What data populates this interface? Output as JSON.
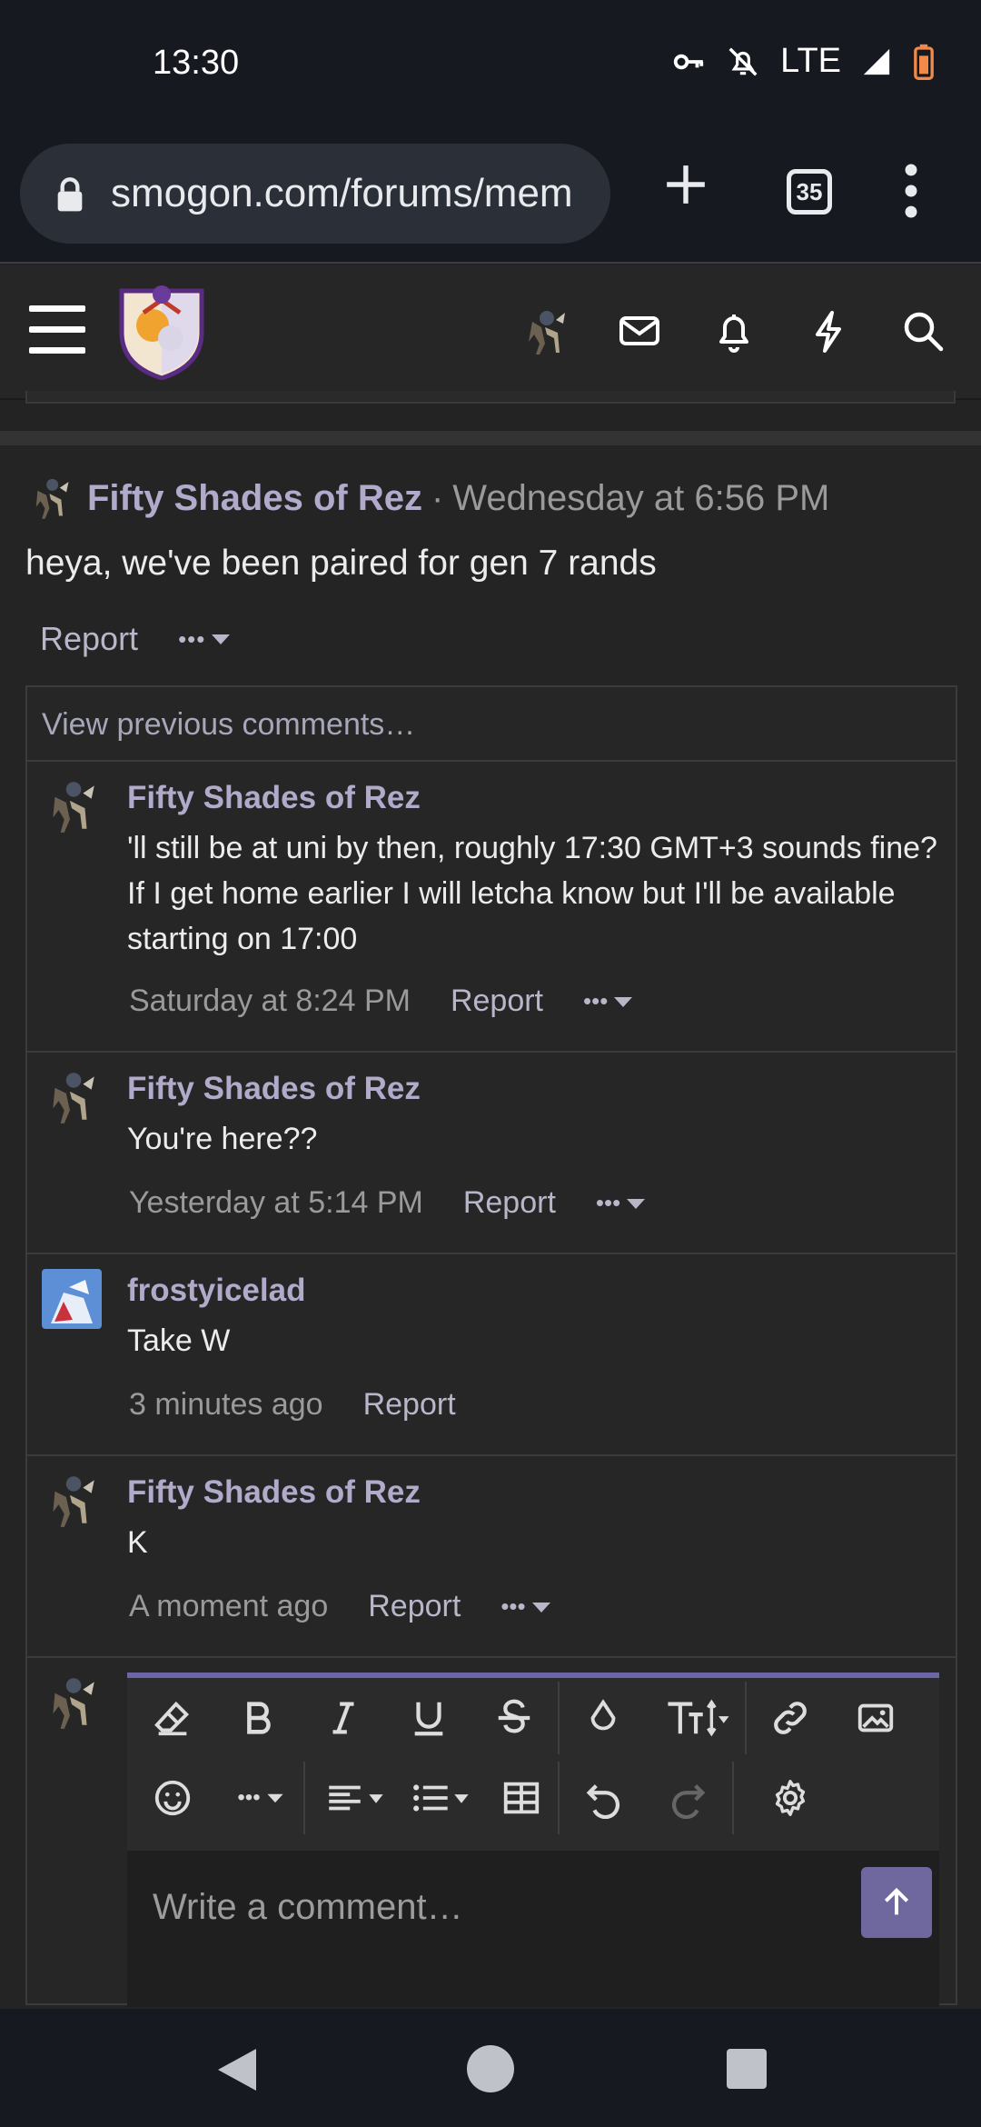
{
  "status_bar": {
    "time": "13:30",
    "network": "LTE",
    "icons": [
      "key-icon",
      "bell-off-icon",
      "signal-icon",
      "battery-icon"
    ]
  },
  "browser": {
    "url": "smogon.com/forums/mem",
    "tab_count": "35",
    "icons": [
      "lock-icon",
      "new-tab-icon",
      "tabs-icon",
      "menu-dots-icon"
    ]
  },
  "site_header": {
    "icons": [
      "hamburger-icon",
      "site-logo",
      "user-avatar",
      "mail-icon",
      "bell-icon",
      "bolt-icon",
      "search-icon"
    ]
  },
  "post": {
    "author": "Fifty Shades of Rez",
    "separator": "·",
    "date": "Wednesday at 6:56 PM",
    "body": "heya, we've been paired for gen 7 rands",
    "report_label": "Report",
    "more_label": "•••"
  },
  "comments": {
    "view_previous": "View previous comments…",
    "items": [
      {
        "author": "Fifty Shades of Rez",
        "text": "'ll still be at uni by then, roughly 17:30 GMT+3 sounds fine? If I get home earlier I will letcha know but I'll be available starting on 17:00",
        "date": "Saturday at 8:24 PM",
        "report": "Report",
        "more": "•••"
      },
      {
        "author": "Fifty Shades of Rez",
        "text": "You're here??",
        "date": "Yesterday at 5:14 PM",
        "report": "Report",
        "more": "•••"
      },
      {
        "author": "frostyicelad",
        "text": "Take W",
        "date": "3 minutes ago",
        "report": "Report"
      },
      {
        "author": "Fifty Shades of Rez",
        "text": "K",
        "date": "A moment ago",
        "report": "Report",
        "more": "•••"
      }
    ]
  },
  "editor": {
    "placeholder": "Write a comment…",
    "toolbar_row1": [
      "eraser-icon",
      "bold-icon",
      "italic-icon",
      "underline-icon",
      "strikethrough-icon",
      "color-drop-icon",
      "font-size-icon",
      "link-icon",
      "image-icon"
    ],
    "toolbar_row2": [
      "smile-icon",
      "more-options-icon",
      "align-icon",
      "list-icon",
      "table-icon",
      "undo-icon",
      "redo-icon",
      "settings-icon"
    ],
    "more_label": "•••"
  },
  "colors": {
    "accent": "#6b66a8",
    "username": "#b2aacb",
    "background": "#242424",
    "system_bar": "#16191f"
  }
}
